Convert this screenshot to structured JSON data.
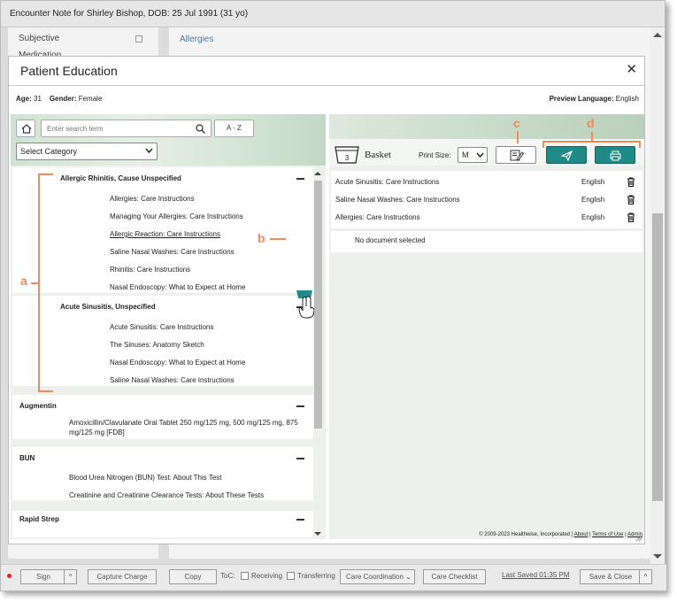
{
  "encounter_title": "Encounter Note for Shirley Bishop, DOB: 25 Jul 1991 (31 yo)",
  "background": {
    "left_items": [
      "Subjective",
      "Medication"
    ],
    "main_heading": "Allergies"
  },
  "modal": {
    "title": "Patient Education",
    "age_label": "Age:",
    "age": "31",
    "gender_label": "Gender:",
    "gender": "Female",
    "preview_language_label": "Preview Language:",
    "preview_language": "English"
  },
  "left_panel": {
    "search_placeholder": "Enter search term",
    "az_label": "A - Z",
    "category_select": "Select Category",
    "sections": [
      {
        "title": "Allergic Rhinitis, Cause Unspecified",
        "items": [
          "Allergies: Care Instructions",
          "Managing Your Allergies: Care Instructions",
          "Allergic Reaction: Care Instructions",
          "Saline Nasal Washes: Care Instructions",
          "Rhinitis: Care Instructions",
          "Nasal Endoscopy: What to Expect at Home"
        ]
      },
      {
        "title": "Acute Sinusitis, Unspecified",
        "items": [
          "Acute Sinusitis: Care Instructions",
          "The Sinuses: Anatomy Sketch",
          "Nasal Endoscopy: What to Expect at Home",
          "Saline Nasal Washes: Care Instructions"
        ]
      },
      {
        "title": "Augmentin",
        "items": [
          "Amoxicillin/Clavulanate Oral Tablet 250 mg/125 mg, 500 mg/125 mg, 875 mg/125 mg [FDB]"
        ]
      },
      {
        "title": "BUN",
        "items": [
          "Blood Urea Nitrogen (BUN) Test: About This Test",
          "Creatinine and Creatinine Clearance Tests: About These Tests"
        ]
      },
      {
        "title": "Rapid Strep",
        "items": []
      }
    ]
  },
  "right_panel": {
    "basket_count": "3",
    "basket_label": "Basket",
    "print_size_label": "Print Size:",
    "print_size_value": "M",
    "basket_items": [
      {
        "title": "Acute Sinusitis: Care Instructions",
        "language": "English"
      },
      {
        "title": "Saline Nasal Washes: Care Instructions",
        "language": "English"
      },
      {
        "title": "Allergies: Care Instructions",
        "language": "English"
      }
    ],
    "no_document": "No document selected",
    "copyright": "© 2009-2023 Healthwise, Incorporated",
    "about": "About",
    "terms": "Terms of Use",
    "admin": "Admin"
  },
  "annotations": {
    "a": "a",
    "b": "b",
    "c": "c",
    "d": "d"
  },
  "bottom_bar": {
    "sign": "Sign",
    "capture_charge": "Capture Charge",
    "copy": "Copy",
    "toc_label": "ToC:",
    "receiving": "Receiving",
    "transferring": "Transferring",
    "care_coordination": "Care Coordination",
    "care_checklist": "Care Checklist",
    "last_saved": "Last Saved 01:35 PM",
    "save_close": "Save & Close"
  },
  "colors": {
    "accent": "#1f8a86",
    "annotation": "#ee8a5e"
  }
}
